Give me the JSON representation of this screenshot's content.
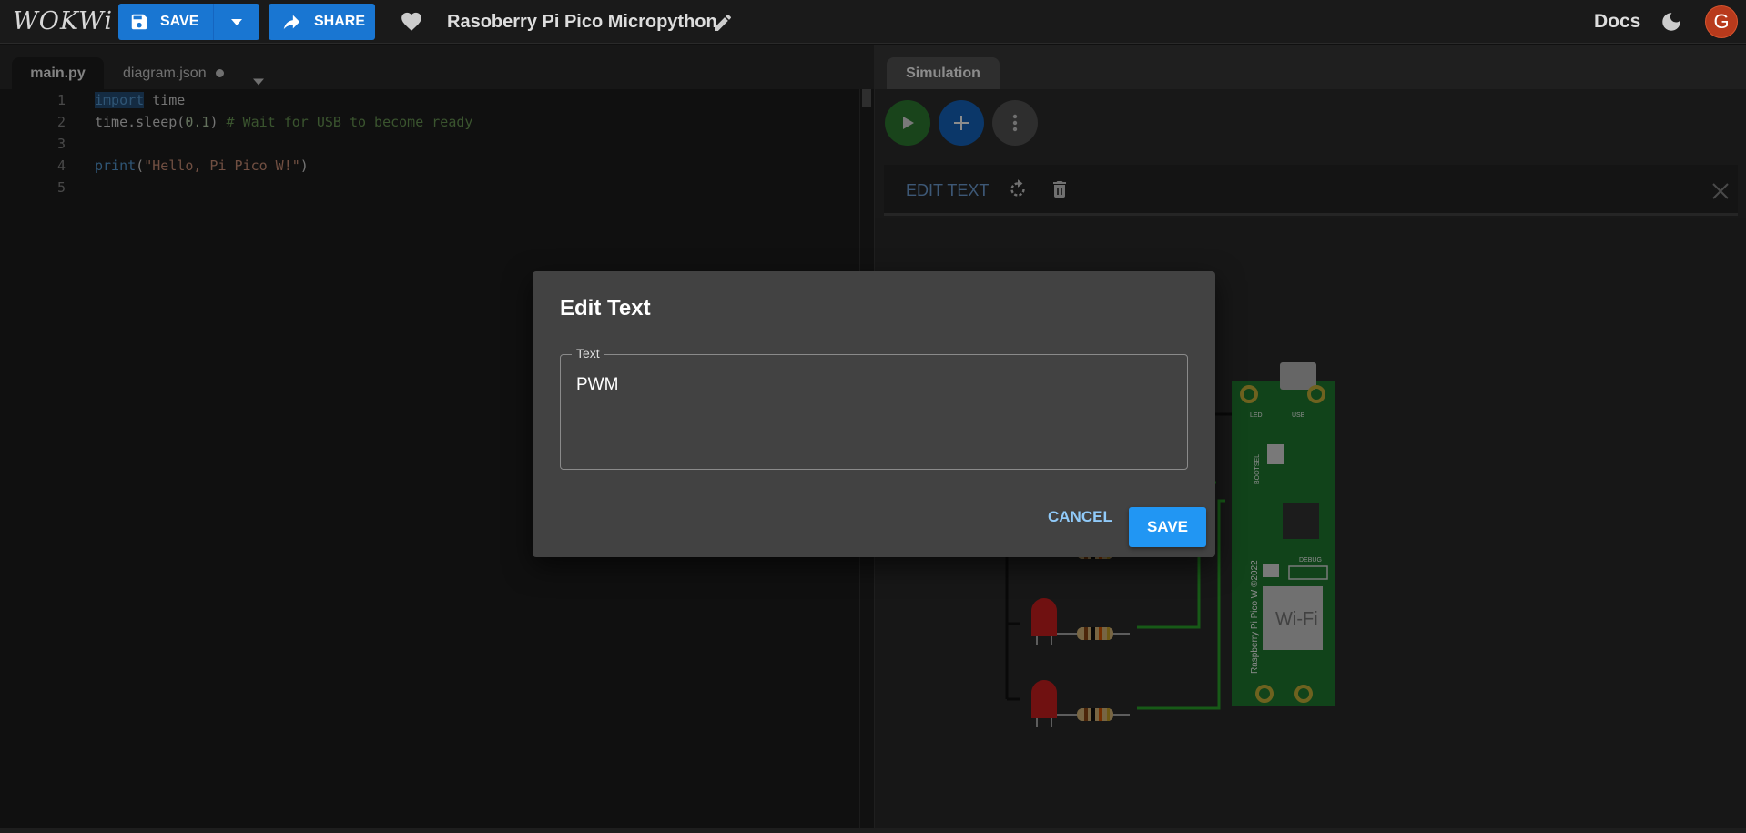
{
  "app": {
    "logo": "WOKWi"
  },
  "toolbar": {
    "save_label": "SAVE",
    "share_label": "SHARE",
    "project_title": "Rasoberry Pi Pico Micropython",
    "docs_label": "Docs",
    "avatar_letter": "G"
  },
  "editor": {
    "tabs": [
      {
        "label": "main.py"
      },
      {
        "label": "diagram.json"
      }
    ],
    "lines": [
      {
        "num": "1",
        "kw": "import",
        "rest": " time"
      },
      {
        "num": "2",
        "fn": "time.sleep(",
        "arg": "0.1",
        "close": ") ",
        "comment": "# Wait for USB to become ready"
      },
      {
        "num": "3"
      },
      {
        "num": "4",
        "kw": "print",
        "open": "(",
        "str": "\"Hello, Pi Pico W!\"",
        "close": ")"
      },
      {
        "num": "5"
      }
    ]
  },
  "simulation": {
    "tab_label": "Simulation",
    "edit_text_label": "EDIT TEXT",
    "board": {
      "led_label": "LED",
      "usb_label": "USB",
      "bootsel_label": "BOOTSEL",
      "debug_label": "DEBUG",
      "wifi_label": "Wi-Fi",
      "name_label": "Raspberry Pi Pico W ©2022"
    }
  },
  "dialog": {
    "title": "Edit Text",
    "field_label": "Text",
    "field_value": "PWM",
    "cancel_label": "CANCEL",
    "save_label": "SAVE"
  },
  "colors": {
    "accent": "#1976d2",
    "run": "#2e7d32",
    "board": "#1f7a30",
    "led": "#cc2020",
    "wire": "#2aa52a"
  }
}
